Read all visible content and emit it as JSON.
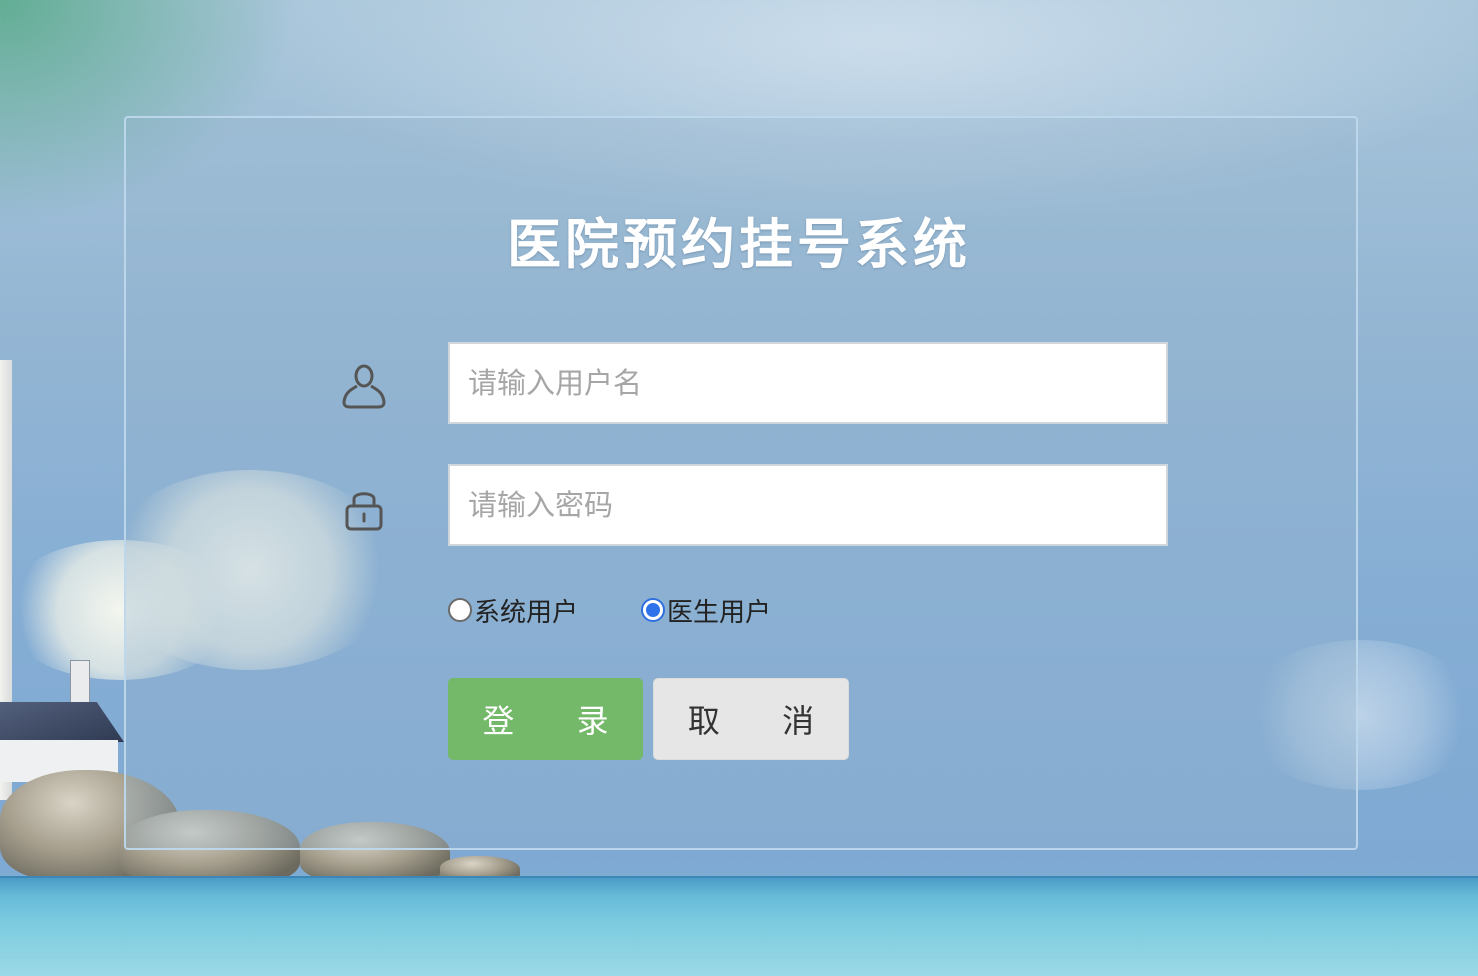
{
  "title": "医院预约挂号系统",
  "username": {
    "placeholder": "请输入用户名",
    "value": "",
    "icon": "user-icon"
  },
  "password": {
    "placeholder": "请输入密码",
    "value": "",
    "icon": "lock-icon"
  },
  "role_options": [
    {
      "label": "系统用户",
      "checked": false
    },
    {
      "label": "医生用户",
      "checked": true
    }
  ],
  "buttons": {
    "login": "登 录",
    "cancel": "取 消"
  },
  "colors": {
    "login_button": "#74b96a",
    "cancel_button": "#e6e6e6",
    "radio_accent": "#2f72ea"
  }
}
